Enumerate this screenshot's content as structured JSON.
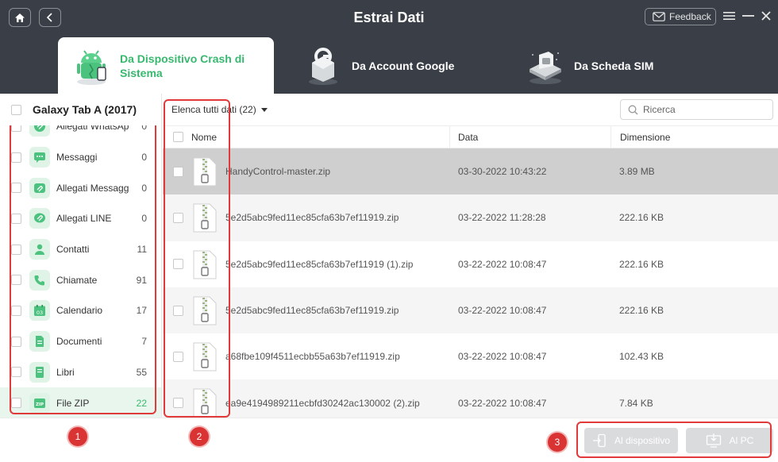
{
  "header": {
    "title": "Estrai Dati",
    "feedback_label": "Feedback",
    "tabs": [
      {
        "label": "Da Dispositivo Crash di Sistema",
        "active": true,
        "icon": "android-crash-icon"
      },
      {
        "label": "Da Account Google",
        "active": false,
        "icon": "google-account-icon"
      },
      {
        "label": "Da Scheda SIM",
        "active": false,
        "icon": "sim-card-icon"
      }
    ]
  },
  "sidebar": {
    "device_name": "Galaxy Tab A (2017)",
    "items": [
      {
        "label": "Allegati WhatsApp",
        "count": "0",
        "icon": "whatsapp-attachment-icon"
      },
      {
        "label": "Messaggi",
        "count": "0",
        "icon": "message-icon"
      },
      {
        "label": "Allegati Messaggi",
        "count": "0",
        "icon": "message-attachment-icon"
      },
      {
        "label": "Allegati LINE",
        "count": "0",
        "icon": "line-attachment-icon"
      },
      {
        "label": "Contatti",
        "count": "11",
        "icon": "contact-icon"
      },
      {
        "label": "Chiamate",
        "count": "91",
        "icon": "phone-icon"
      },
      {
        "label": "Calendario",
        "count": "17",
        "icon": "calendar-icon"
      },
      {
        "label": "Documenti",
        "count": "7",
        "icon": "document-icon"
      },
      {
        "label": "Libri",
        "count": "55",
        "icon": "book-icon"
      },
      {
        "label": "File ZIP",
        "count": "22",
        "icon": "zip-icon",
        "active": true
      }
    ]
  },
  "main": {
    "filter_label": "Elenca tutti dati (22)",
    "search_placeholder": "Ricerca",
    "columns": {
      "name": "Nome",
      "date": "Data",
      "size": "Dimensione"
    },
    "rows": [
      {
        "name": "HandyControl-master.zip",
        "date": "03-30-2022 10:43:22",
        "size": "3.89 MB",
        "selected": true
      },
      {
        "name": "5e2d5abc9fed11ec85cfa63b7ef11919.zip",
        "date": "03-22-2022 11:28:28",
        "size": "222.16 KB"
      },
      {
        "name": "5e2d5abc9fed11ec85cfa63b7ef11919 (1).zip",
        "date": "03-22-2022 10:08:47",
        "size": "222.16 KB"
      },
      {
        "name": "5e2d5abc9fed11ec85cfa63b7ef11919.zip",
        "date": "03-22-2022 10:08:47",
        "size": "222.16 KB"
      },
      {
        "name": "a68fbe109f4511ecbb55a63b7ef11919.zip",
        "date": "03-22-2022 10:08:47",
        "size": "102.43 KB"
      },
      {
        "name": "ea9e4194989211ecbfd30242ac130002 (2).zip",
        "date": "03-22-2022 10:08:47",
        "size": "7.84 KB"
      }
    ]
  },
  "footer": {
    "device_button": "Al dispositivo",
    "pc_button": "Al PC"
  },
  "annotations": [
    "1",
    "2",
    "3"
  ],
  "colors": {
    "header_bg": "#3a3f47",
    "accent_green": "#38b86f",
    "annotation_red": "#e03a3a",
    "disabled_button": "#d9dbdc"
  }
}
